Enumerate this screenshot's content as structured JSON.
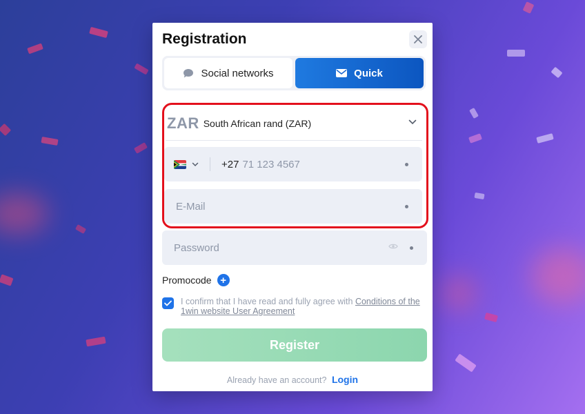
{
  "modal": {
    "title": "Registration",
    "close_icon": "close-icon"
  },
  "tabs": [
    {
      "label": "Social networks",
      "icon": "chat-bubble-icon",
      "active": false
    },
    {
      "label": "Quick",
      "icon": "envelope-icon",
      "active": true
    }
  ],
  "form": {
    "currency": {
      "code": "ZAR",
      "name": "South African rand (ZAR)"
    },
    "phone": {
      "country_flag": "south-africa-flag-icon",
      "dial_code": "+27",
      "placeholder": "71 123 4567"
    },
    "email": {
      "placeholder": "E-Mail"
    },
    "password": {
      "placeholder": "Password"
    },
    "promocode_label": "Promocode",
    "agreement": {
      "text": "I confirm that I have read and fully agree with",
      "link": "Conditions of the 1win website User Agreement",
      "checked": true
    },
    "register_label": "Register",
    "login_prompt": "Already have an account?",
    "login_link": "Login"
  },
  "colors": {
    "accent": "#1f73e8",
    "highlight": "#e3101c",
    "register": "#8cd6ae"
  }
}
